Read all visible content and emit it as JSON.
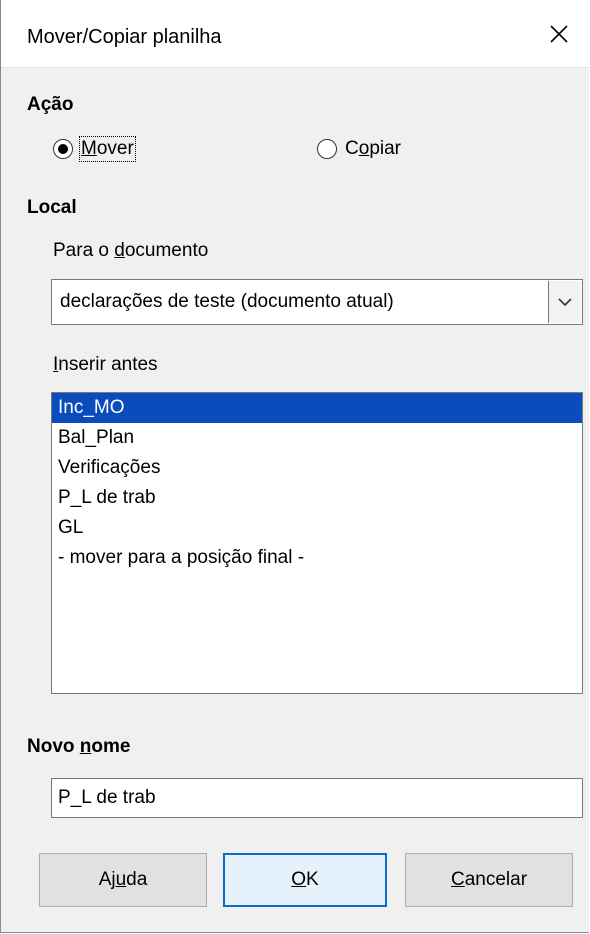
{
  "window": {
    "title": "Mover/Copiar planilha",
    "close_glyph": "✕"
  },
  "action": {
    "label_prefix": "Ação",
    "move": {
      "label_pre": "",
      "mnemonic": "M",
      "label_post": "over",
      "selected": true
    },
    "copy": {
      "label_pre": "C",
      "mnemonic": "o",
      "label_post": "piar",
      "selected": false
    }
  },
  "local": {
    "label": "Local",
    "to_document": {
      "label_pre": "Para o ",
      "mnemonic": "d",
      "label_post": "ocumento"
    },
    "document_value": "declarações de teste (documento atual)",
    "insert_before": {
      "label_pre": "",
      "mnemonic": "I",
      "label_post": "nserir antes"
    },
    "items": [
      {
        "text": "Inc_MO",
        "selected": true
      },
      {
        "text": "Bal_Plan",
        "selected": false
      },
      {
        "text": "Verificações",
        "selected": false
      },
      {
        "text": "P_L de trab",
        "selected": false
      },
      {
        "text": "GL",
        "selected": false
      },
      {
        "text": "- mover para a posição final -",
        "selected": false
      }
    ]
  },
  "new_name": {
    "label_pre": "Novo ",
    "mnemonic": "n",
    "label_post": "ome",
    "value": "P_L de trab"
  },
  "buttons": {
    "help": {
      "pre": "Aj",
      "mnemonic": "u",
      "post": "da"
    },
    "ok": {
      "pre": "",
      "mnemonic": "O",
      "post": "K"
    },
    "cancel": {
      "pre": "",
      "mnemonic": "C",
      "post": "ancelar"
    }
  },
  "colors": {
    "selection": "#0a4cbc",
    "default_button_border": "#0a6ed1"
  }
}
